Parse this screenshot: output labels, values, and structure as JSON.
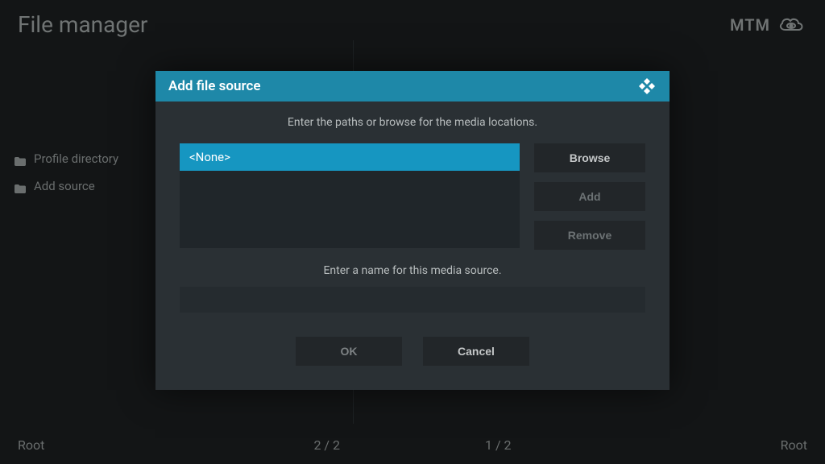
{
  "header": {
    "title": "File manager",
    "brand": "MTM"
  },
  "sidebar": {
    "items": [
      {
        "label": "Profile directory"
      },
      {
        "label": "Add source"
      }
    ]
  },
  "modal": {
    "title": "Add file source",
    "instruction": "Enter the paths or browse for the media locations.",
    "selected_path": "<None>",
    "buttons": {
      "browse": "Browse",
      "add": "Add",
      "remove": "Remove"
    },
    "name_label": "Enter a name for this media source.",
    "name_value": "",
    "ok": "OK",
    "cancel": "Cancel"
  },
  "footer": {
    "left_label": "Root",
    "left_count": "2 / 2",
    "right_count": "1 / 2",
    "right_label": "Root"
  }
}
